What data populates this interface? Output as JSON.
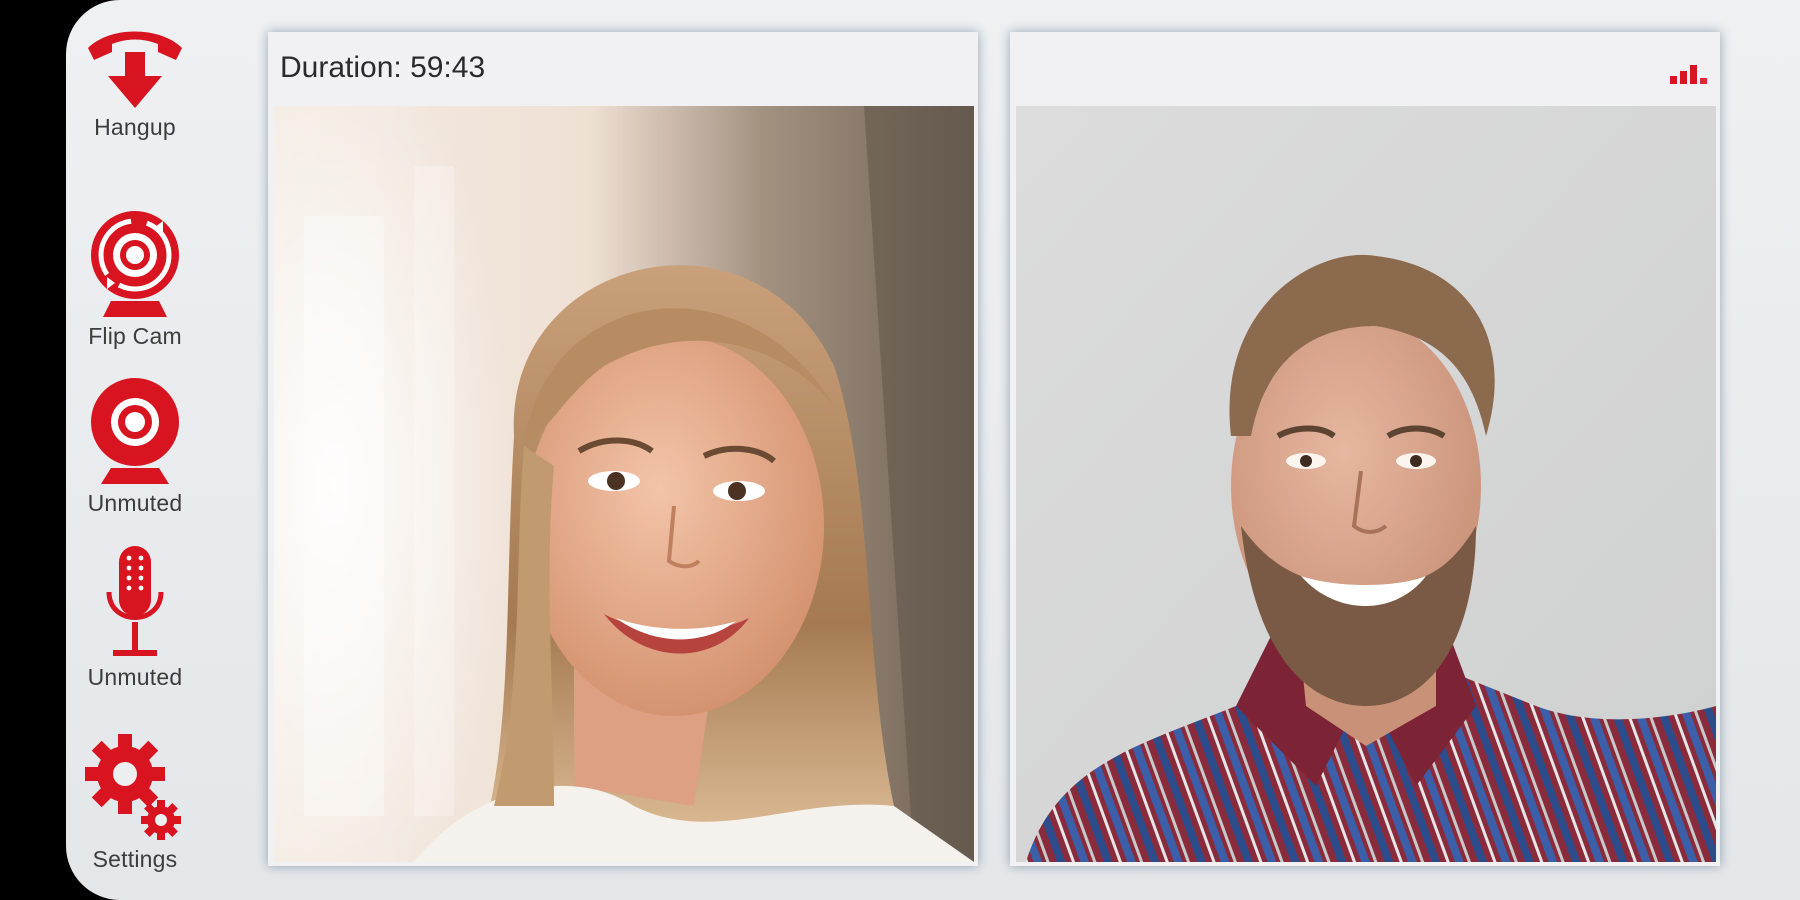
{
  "colors": {
    "accent": "#d7141f",
    "label": "#3c3c3c",
    "panel_bg": "#f1f1f3",
    "app_bg": "#e8eaec"
  },
  "sidebar": {
    "items": [
      {
        "label": "Hangup",
        "icon": "hangup-phone-icon"
      },
      {
        "label": "Flip Cam",
        "icon": "flip-camera-icon"
      },
      {
        "label": "Unmuted",
        "icon": "webcam-icon"
      },
      {
        "label": "Unmuted",
        "icon": "microphone-icon"
      },
      {
        "label": "Settings",
        "icon": "gear-icon"
      }
    ]
  },
  "local_panel": {
    "duration_text": "Duration: 59:43"
  },
  "remote_panel": {
    "signal_icon": "signal-strength-icon",
    "signal_level": 0.75
  }
}
